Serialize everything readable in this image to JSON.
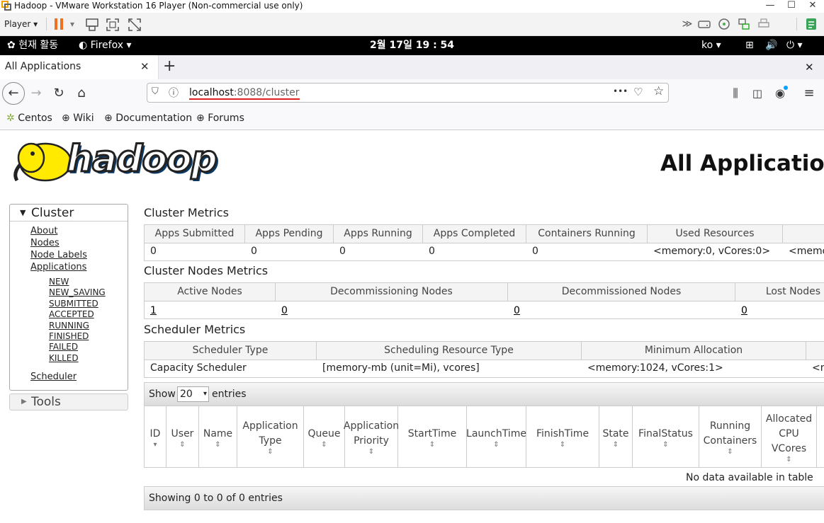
{
  "vm": {
    "title": "Hadoop - VMware Workstation 16 Player (Non-commercial use only)",
    "player_menu": "Player",
    "minimize": "—",
    "maximize": "☐",
    "close": "✕"
  },
  "gnome": {
    "activities": "현재 활동",
    "app": "Firefox",
    "clock": "2월 17일  19 : 54",
    "lang": "ko"
  },
  "browser": {
    "tab_title": "All Applications",
    "tab_close": "✕",
    "new_tab": "+",
    "window_close": "✕",
    "url_host": "localhost",
    "url_rest": ":8088/cluster",
    "url_more": "•••",
    "bookmarks": [
      "Centos",
      "Wiki",
      "Documentation",
      "Forums"
    ]
  },
  "page": {
    "logo_text": "hadoop",
    "heading": "All Applications",
    "sidebar": {
      "cluster_label": "Cluster",
      "cluster_links": [
        "About",
        "Nodes",
        "Node Labels",
        "Applications"
      ],
      "app_states": [
        "NEW",
        "NEW_SAVING",
        "SUBMITTED",
        "ACCEPTED",
        "RUNNING",
        "FINISHED",
        "FAILED",
        "KILLED"
      ],
      "scheduler_link": "Scheduler",
      "tools_label": "Tools"
    },
    "cluster_metrics": {
      "title": "Cluster Metrics",
      "headers": [
        "Apps Submitted",
        "Apps Pending",
        "Apps Running",
        "Apps Completed",
        "Containers Running",
        "Used Resources"
      ],
      "values": [
        "0",
        "0",
        "0",
        "0",
        "0",
        "<memory:0, vCores:0>",
        "<memo"
      ]
    },
    "nodes_metrics": {
      "title": "Cluster Nodes Metrics",
      "headers": [
        "Active Nodes",
        "Decommissioning Nodes",
        "Decommissioned Nodes",
        "Lost Nodes"
      ],
      "values": [
        "1",
        "0",
        "0",
        "0"
      ]
    },
    "scheduler_metrics": {
      "title": "Scheduler Metrics",
      "headers": [
        "Scheduler Type",
        "Scheduling Resource Type",
        "Minimum Allocation"
      ],
      "values": [
        "Capacity Scheduler",
        "[memory-mb (unit=Mi), vcores]",
        "<memory:1024, vCores:1>",
        "<m"
      ]
    },
    "apps_table": {
      "show_label": "Show",
      "page_size": "20",
      "entries_label": "entries",
      "columns": [
        [
          "ID"
        ],
        [
          "User"
        ],
        [
          "Name"
        ],
        [
          "Application",
          "Type"
        ],
        [
          "Queue"
        ],
        [
          "Application",
          "Priority"
        ],
        [
          "StartTime"
        ],
        [
          "LaunchTime"
        ],
        [
          "FinishTime"
        ],
        [
          "State"
        ],
        [
          "FinalStatus"
        ],
        [
          "Running",
          "Containers"
        ],
        [
          "Allocated",
          "CPU",
          "VCores"
        ]
      ],
      "empty_message": "No data available in table",
      "footer": "Showing 0 to 0 of 0 entries"
    }
  },
  "colors": {
    "gnome_bar": "#000000",
    "url_underline": "#e02020",
    "pause": "#f07020"
  }
}
